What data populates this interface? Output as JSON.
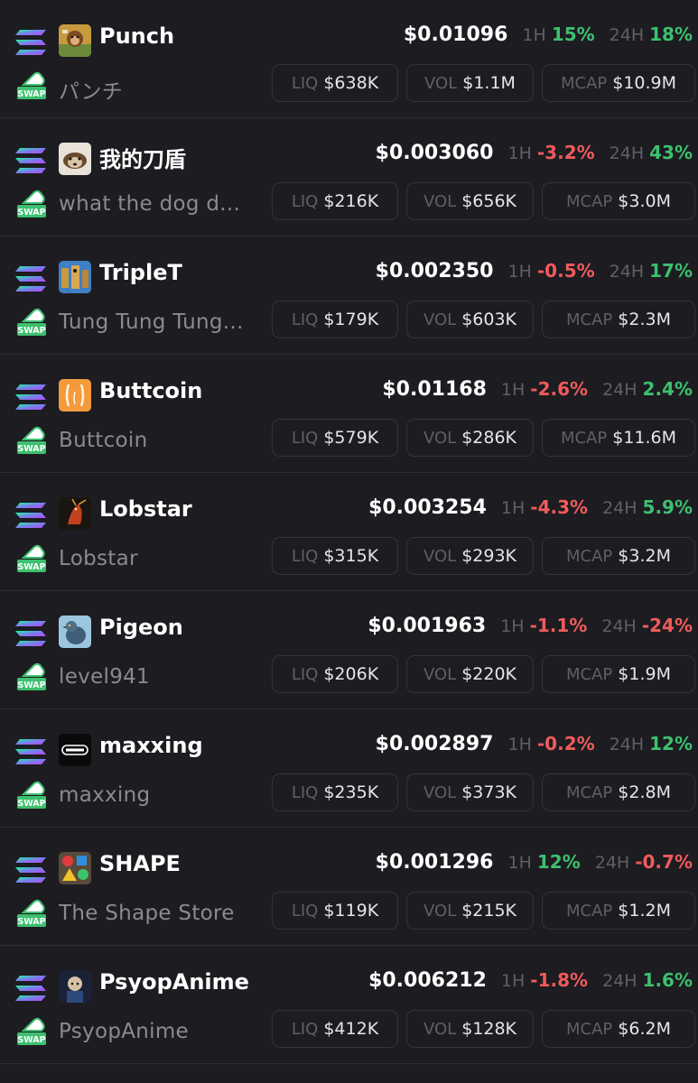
{
  "colors": {
    "background": "#1c1c21",
    "positive": "#3dc06f",
    "negative": "#ef5b5b",
    "muted": "#5f5f68",
    "divider": "#2e2e35"
  },
  "labels": {
    "hour": "1H",
    "day": "24H",
    "liquidity": "LIQ",
    "volume": "VOL",
    "market_cap": "MCAP",
    "swap_badge": "SWAP"
  },
  "chain_icon": "solana-icon",
  "tokens": [
    {
      "symbol": "Punch",
      "name": "パンチ",
      "price": "$0.01096",
      "change_1h": "15%",
      "change_24h": "18%",
      "up_1h": true,
      "up_24h": true,
      "liq": "$638K",
      "vol": "$1.1M",
      "mcap": "$10.9M",
      "image": "monkey-avatar-icon"
    },
    {
      "symbol": "我的刀盾",
      "name": "what the dog d...",
      "price": "$0.003060",
      "change_1h": "-3.2%",
      "change_24h": "43%",
      "up_1h": false,
      "up_24h": true,
      "liq": "$216K",
      "vol": "$656K",
      "mcap": "$3.0M",
      "image": "dog-avatar-icon"
    },
    {
      "symbol": "TripleT",
      "name": "Tung Tung Tung...",
      "price": "$0.002350",
      "change_1h": "-0.5%",
      "change_24h": "17%",
      "up_1h": false,
      "up_24h": true,
      "liq": "$179K",
      "vol": "$603K",
      "mcap": "$2.3M",
      "image": "cartoon-avatar-icon"
    },
    {
      "symbol": "Buttcoin",
      "name": "Buttcoin",
      "price": "$0.01168",
      "change_1h": "-2.6%",
      "change_24h": "2.4%",
      "up_1h": false,
      "up_24h": true,
      "liq": "$579K",
      "vol": "$286K",
      "mcap": "$11.6M",
      "image": "buttcoin-logo-icon"
    },
    {
      "symbol": "Lobstar",
      "name": "Lobstar",
      "price": "$0.003254",
      "change_1h": "-4.3%",
      "change_24h": "5.9%",
      "up_1h": false,
      "up_24h": true,
      "liq": "$315K",
      "vol": "$293K",
      "mcap": "$3.2M",
      "image": "lobster-avatar-icon"
    },
    {
      "symbol": "Pigeon",
      "name": "level941",
      "price": "$0.001963",
      "change_1h": "-1.1%",
      "change_24h": "-24%",
      "up_1h": false,
      "up_24h": false,
      "liq": "$206K",
      "vol": "$220K",
      "mcap": "$1.9M",
      "image": "pigeon-avatar-icon"
    },
    {
      "symbol": "maxxing",
      "name": "maxxing",
      "price": "$0.002897",
      "change_1h": "-0.2%",
      "change_24h": "12%",
      "up_1h": false,
      "up_24h": true,
      "liq": "$235K",
      "vol": "$373K",
      "mcap": "$2.8M",
      "image": "maxxing-logo-icon"
    },
    {
      "symbol": "SHAPE",
      "name": "The Shape Store",
      "price": "$0.001296",
      "change_1h": "12%",
      "change_24h": "-0.7%",
      "up_1h": true,
      "up_24h": false,
      "liq": "$119K",
      "vol": "$215K",
      "mcap": "$1.2M",
      "image": "shapes-avatar-icon"
    },
    {
      "symbol": "PsyopAnime",
      "name": "PsyopAnime",
      "price": "$0.006212",
      "change_1h": "-1.8%",
      "change_24h": "1.6%",
      "up_1h": false,
      "up_24h": true,
      "liq": "$412K",
      "vol": "$128K",
      "mcap": "$6.2M",
      "image": "anime-avatar-icon"
    }
  ]
}
